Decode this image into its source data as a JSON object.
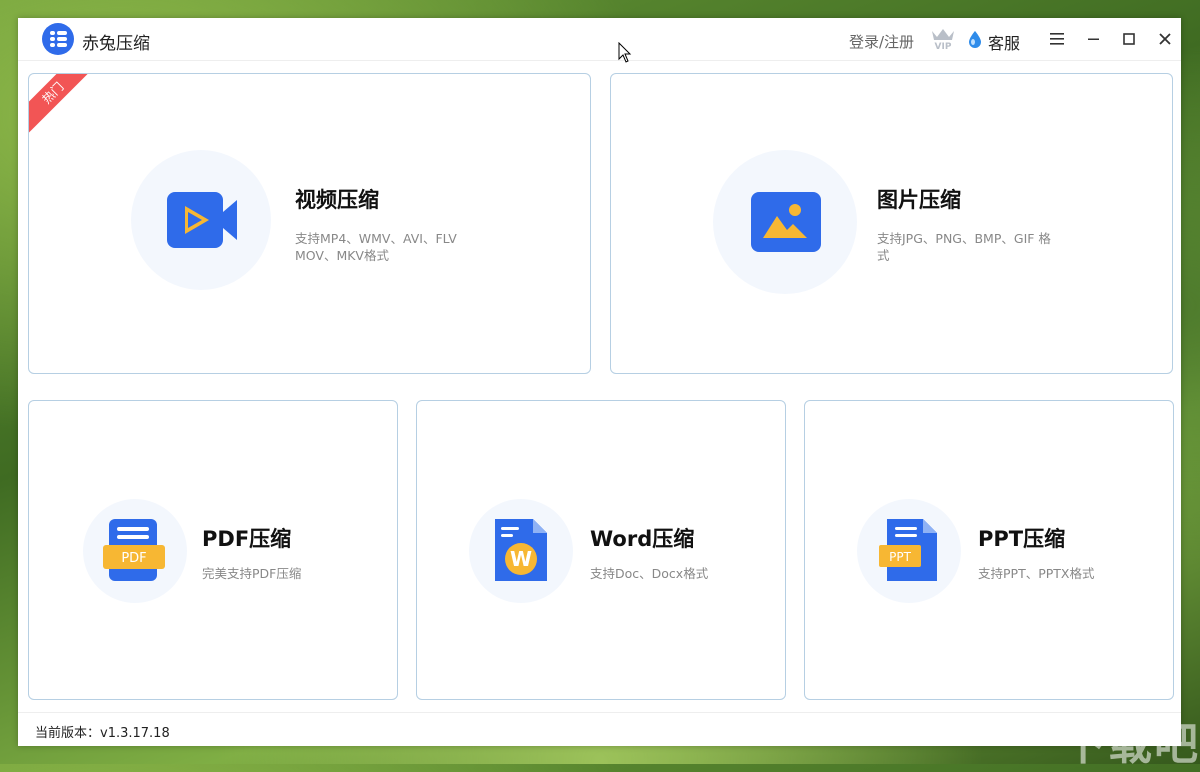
{
  "app": {
    "title": "赤兔压缩"
  },
  "header": {
    "login_label": "登录/注册",
    "vip_label": "VIP",
    "service_label": "客服"
  },
  "cards": {
    "video": {
      "badge": "热门",
      "title": "视频压缩",
      "desc_line1": "支持MP4、WMV、AVI、FLV",
      "desc_line2": "MOV、MKV格式"
    },
    "image": {
      "title": "图片压缩",
      "desc_line1": "支持JPG、PNG、BMP、GIF 格",
      "desc_line2": "式"
    },
    "pdf": {
      "title": "PDF压缩",
      "desc": "完美支持PDF压缩",
      "icon_text": "PDF"
    },
    "word": {
      "title": "Word压缩",
      "desc": "支持Doc、Docx格式",
      "icon_text": "W"
    },
    "ppt": {
      "title": "PPT压缩",
      "desc": "支持PPT、PPTX格式",
      "icon_text": "PPT"
    }
  },
  "footer": {
    "version": "当前版本：v1.3.17.18"
  },
  "watermark": "下载吧",
  "colors": {
    "accent": "#2f6bea",
    "hot_badge": "#f25555",
    "icon_yellow": "#f7b733",
    "card_border": "#b6cfe3"
  }
}
